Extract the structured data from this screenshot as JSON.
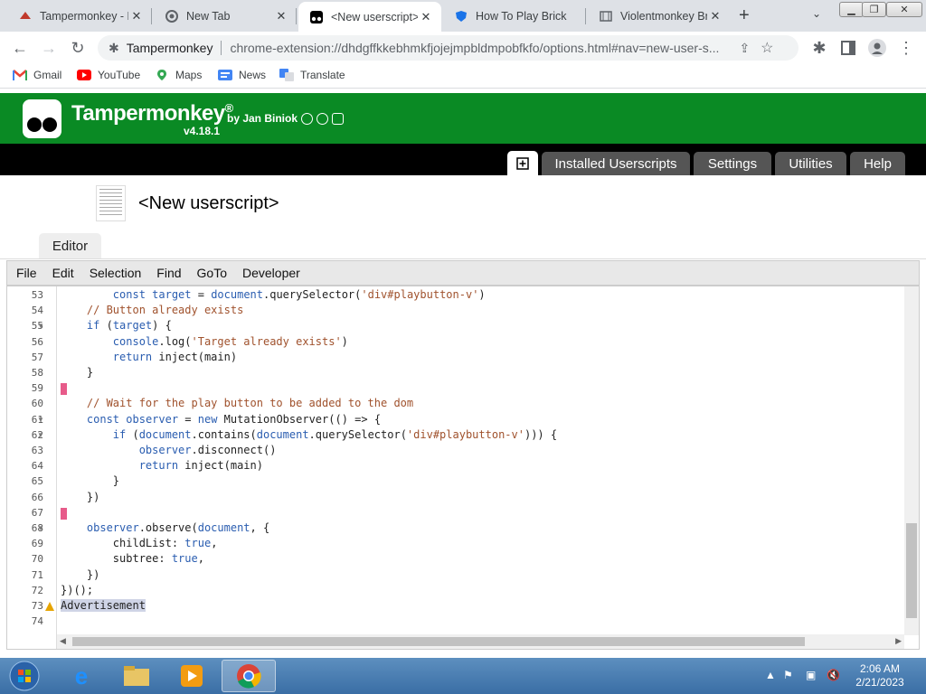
{
  "tabs": [
    {
      "label": "Tampermonkey - M",
      "active": false
    },
    {
      "label": "New Tab",
      "active": false
    },
    {
      "label": "<New userscript>",
      "active": true
    },
    {
      "label": "How To Play Brick",
      "active": false
    },
    {
      "label": "Violentmonkey Br",
      "active": false
    }
  ],
  "omnibox": {
    "site": "Tampermonkey",
    "url": "chrome-extension://dhdgffkkebhmkfjojejmpbldmpobfkfo/options.html#nav=new-user-s..."
  },
  "bookmarks": [
    "Gmail",
    "YouTube",
    "Maps",
    "News",
    "Translate"
  ],
  "header": {
    "title": "Tampermonkey",
    "reg": "®",
    "version": "v4.18.1",
    "author": "by Jan Biniok"
  },
  "nav_tabs": [
    "Installed Userscripts",
    "Settings",
    "Utilities",
    "Help"
  ],
  "script_name": "<New userscript>",
  "editor_tab": "Editor",
  "menu": [
    "File",
    "Edit",
    "Selection",
    "Find",
    "GoTo",
    "Developer"
  ],
  "code_lines": [
    {
      "n": "53",
      "text": "        const target = document.querySelector('div#playbutton-v')"
    },
    {
      "n": "54",
      "text": "    // Button already exists"
    },
    {
      "n": "55",
      "text": "    if (target) {"
    },
    {
      "n": "56",
      "text": "        console.log('Target already exists')"
    },
    {
      "n": "57",
      "text": "        return inject(main)"
    },
    {
      "n": "58",
      "text": "    }"
    },
    {
      "n": "59",
      "text": ""
    },
    {
      "n": "60",
      "text": "    // Wait for the play button to be added to the dom"
    },
    {
      "n": "61",
      "text": "    const observer = new MutationObserver(() => {"
    },
    {
      "n": "62",
      "text": "        if (document.contains(document.querySelector('div#playbutton-v'))) {"
    },
    {
      "n": "63",
      "text": "            observer.disconnect()"
    },
    {
      "n": "64",
      "text": "            return inject(main)"
    },
    {
      "n": "65",
      "text": "        }"
    },
    {
      "n": "66",
      "text": "    })"
    },
    {
      "n": "67",
      "text": ""
    },
    {
      "n": "68",
      "text": "    observer.observe(document, {"
    },
    {
      "n": "69",
      "text": "        childList: true,"
    },
    {
      "n": "70",
      "text": "        subtree: true,"
    },
    {
      "n": "71",
      "text": "    })"
    },
    {
      "n": "72",
      "text": "})();"
    },
    {
      "n": "73",
      "text": "Advertisement"
    },
    {
      "n": "74",
      "text": ""
    }
  ],
  "clock": {
    "time": "2:06 AM",
    "date": "2/21/2023"
  },
  "colors": {
    "tm_green": "#0a8a24",
    "marker": "#e75b8a"
  }
}
